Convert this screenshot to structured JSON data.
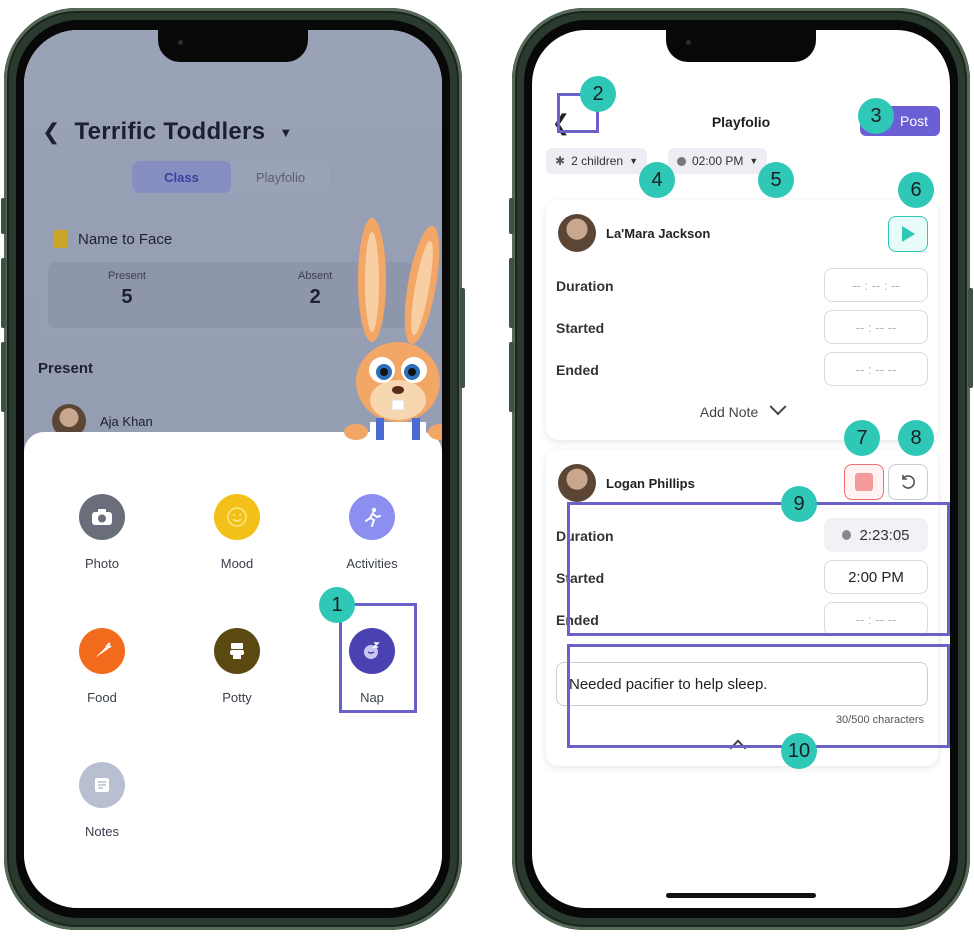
{
  "left_screen": {
    "header": {
      "title": "Terrific Toddlers"
    },
    "tabs": [
      {
        "label": "Class"
      },
      {
        "label": "Playfolio"
      }
    ],
    "name_to_face": {
      "title": "Name to Face",
      "present_label": "Present",
      "present_count": "5",
      "absent_label": "Absent",
      "absent_count": "2"
    },
    "present_heading": "Present",
    "first_child": "Aja Khan",
    "activities": [
      {
        "label": "Photo",
        "icon": "camera-icon",
        "color": "#6a6e7a"
      },
      {
        "label": "Mood",
        "icon": "smiley-icon",
        "color": "#f2c019"
      },
      {
        "label": "Activities",
        "icon": "running-person-icon",
        "color": "#8d8ff0"
      },
      {
        "label": "Food",
        "icon": "carrot-icon",
        "color": "#f26a1b"
      },
      {
        "label": "Potty",
        "icon": "toilet-icon",
        "color": "#5a4a12"
      },
      {
        "label": "Nap",
        "icon": "sleep-icon",
        "color": "#4a42b0"
      },
      {
        "label": "Notes",
        "icon": "note-icon",
        "color": "#b7bfd0"
      }
    ],
    "callout": "1"
  },
  "right_screen": {
    "title": "Playfolio",
    "post_label": "Post",
    "children_chip": "2 children",
    "time_chip": "02:00 PM",
    "child1": {
      "name": "La'Mara Jackson",
      "duration_label": "Duration",
      "duration_value": "-- : -- : --",
      "started_label": "Started",
      "started_value": "-- : --  --",
      "ended_label": "Ended",
      "ended_value": "-- : --  --",
      "add_note": "Add Note"
    },
    "child2": {
      "name": "Logan Phillips",
      "duration_label": "Duration",
      "duration_value": "2:23:05",
      "started_label": "Started",
      "started_value": "2:00 PM",
      "ended_label": "Ended",
      "ended_value": "-- : --  --",
      "note_text": "Needed pacifier to help sleep.",
      "char_count": "30/500 characters"
    },
    "callouts": [
      "2",
      "3",
      "4",
      "5",
      "6",
      "7",
      "8",
      "9",
      "10"
    ]
  },
  "colors": {
    "accent": "#6b5fd6",
    "callout": "#2fc7b5",
    "highlight": "#6a61c9",
    "play": "#2fc7b5",
    "stop": "#f26d6d"
  }
}
